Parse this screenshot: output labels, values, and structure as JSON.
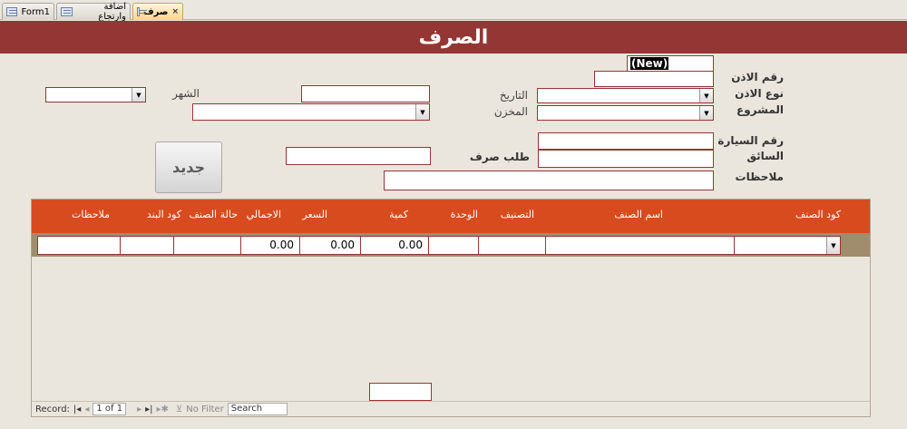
{
  "tabs": [
    {
      "label": "Form1",
      "active": false
    },
    {
      "label": "اضافة وارتجاع",
      "active": false
    },
    {
      "label": "صرف",
      "active": true
    }
  ],
  "header": {
    "title": "الصرف"
  },
  "form": {
    "permit_no_label": "رقم الاذن",
    "permit_type_label": "نوع الاذن",
    "project_label": "المشروع",
    "date_label": "التاريخ",
    "warehouse_label": "المخزن",
    "month_label": "الشهر",
    "car_no_label": "رقم السيارة",
    "driver_label": "السائق",
    "request_label": "طلب صرف",
    "notes_label": "ملاحظات",
    "new_value": "(New)",
    "new_button": "جديد"
  },
  "subform": {
    "columns": [
      "كود الصنف",
      "اسم الصنف",
      "التصنيف",
      "الوحدة",
      "كمية",
      "السعر",
      "الاجمالي",
      "حالة الصنف",
      "كود البند",
      "ملاحظات"
    ],
    "row": {
      "quantity": "0.00",
      "price": "0.00",
      "total": "0.00"
    },
    "nav": {
      "record_label": "Record:",
      "record_value": "1 of 1",
      "filter_label": "No Filter",
      "search_label": "Search"
    }
  }
}
